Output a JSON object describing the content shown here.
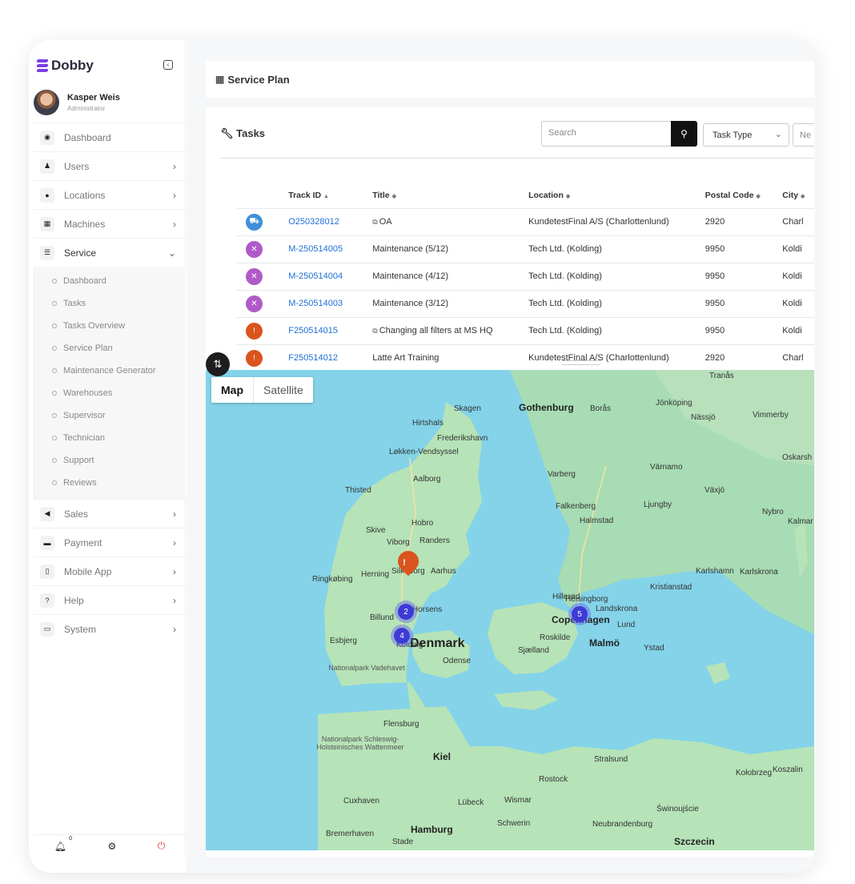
{
  "app": {
    "name": "Dobby"
  },
  "user": {
    "name": "Kasper Weis",
    "role": "Administrator"
  },
  "sidebar": {
    "items": [
      {
        "label": "Dashboard",
        "icon": "dashboard-icon",
        "glyph": "◉",
        "chevron": ""
      },
      {
        "label": "Users",
        "icon": "users-icon",
        "glyph": "♟",
        "chevron": "›"
      },
      {
        "label": "Locations",
        "icon": "location-pin-icon",
        "glyph": "●",
        "chevron": "›"
      },
      {
        "label": "Machines",
        "icon": "machine-icon",
        "glyph": "▦",
        "chevron": "›"
      },
      {
        "label": "Service",
        "icon": "list-icon",
        "glyph": "☰",
        "chevron": "⌄"
      }
    ],
    "service_sub": [
      "Dashboard",
      "Tasks",
      "Tasks Overview",
      "Service Plan",
      "Maintenance Generator",
      "Warehouses",
      "Supervisor",
      "Technician",
      "Support",
      "Reviews"
    ],
    "items_after": [
      {
        "label": "Sales",
        "icon": "megaphone-icon",
        "glyph": "◀",
        "chevron": "›"
      },
      {
        "label": "Payment",
        "icon": "credit-card-icon",
        "glyph": "▬",
        "chevron": "›"
      },
      {
        "label": "Mobile App",
        "icon": "mobile-icon",
        "glyph": "▯",
        "chevron": "›"
      },
      {
        "label": "Help",
        "icon": "help-icon",
        "glyph": "?",
        "chevron": "›"
      },
      {
        "label": "System",
        "icon": "laptop-icon",
        "glyph": "▭",
        "chevron": "›"
      }
    ],
    "footer": {
      "notifications": "0"
    }
  },
  "page": {
    "title": "Service Plan"
  },
  "tasks": {
    "title": "Tasks",
    "search_placeholder": "Search",
    "task_type": "Task Type",
    "second_filter": "Ne",
    "columns": [
      "Track ID",
      "Title",
      "Location",
      "Postal Code",
      "City"
    ],
    "column_arrows": [
      "▲",
      "◆",
      "◆",
      "◆",
      "◆"
    ],
    "rows": [
      {
        "status": "blue",
        "glyph": "⛟",
        "id": "O250328012",
        "copy": true,
        "title": "OA",
        "location": "KundetestFinal A/S (Charlottenlund)",
        "postal": "2920",
        "city": "Charl"
      },
      {
        "status": "purple",
        "glyph": "✕",
        "id": "M-250514005",
        "copy": false,
        "title": "Maintenance (5/12)",
        "location": "Tech Ltd. (Kolding)",
        "postal": "9950",
        "city": "Koldi"
      },
      {
        "status": "purple",
        "glyph": "✕",
        "id": "M-250514004",
        "copy": false,
        "title": "Maintenance (4/12)",
        "location": "Tech Ltd. (Kolding)",
        "postal": "9950",
        "city": "Koldi"
      },
      {
        "status": "purple",
        "glyph": "✕",
        "id": "M-250514003",
        "copy": false,
        "title": "Maintenance (3/12)",
        "location": "Tech Ltd. (Kolding)",
        "postal": "9950",
        "city": "Koldi"
      },
      {
        "status": "orange",
        "glyph": "!",
        "id": "F250514015",
        "copy": true,
        "title": "Changing all filters at MS HQ",
        "location": "Tech Ltd. (Kolding)",
        "postal": "9950",
        "city": "Koldi"
      },
      {
        "status": "orange",
        "glyph": "!",
        "id": "F250514012",
        "copy": false,
        "title": "Latte Art Training",
        "location": "KundetestFinal A/S (Charlottenlund)",
        "postal": "2920",
        "city": "Charl"
      }
    ]
  },
  "map": {
    "toggle": {
      "map": "Map",
      "satellite": "Satellite"
    },
    "clusters": [
      {
        "count": "2"
      },
      {
        "count": "4"
      },
      {
        "count": "5"
      }
    ],
    "labels": [
      {
        "text": "Denmark",
        "size": "big"
      },
      {
        "text": "Gothenburg",
        "size": "med"
      },
      {
        "text": "Copenhagen",
        "size": "med"
      },
      {
        "text": "Malmö",
        "size": "med"
      },
      {
        "text": "Hamburg",
        "size": "med"
      },
      {
        "text": "Szczecin",
        "size": "med"
      },
      {
        "text": "Kiel",
        "size": "med"
      },
      {
        "text": "Aalborg",
        "size": "normal"
      },
      {
        "text": "Aarhus",
        "size": "normal"
      },
      {
        "text": "Randers",
        "size": "normal"
      },
      {
        "text": "Odense",
        "size": "normal"
      },
      {
        "text": "Kolding",
        "size": "normal"
      },
      {
        "text": "Horsens",
        "size": "normal"
      },
      {
        "text": "Esbjerg",
        "size": "normal"
      },
      {
        "text": "Herning",
        "size": "normal"
      },
      {
        "text": "Viborg",
        "size": "normal"
      },
      {
        "text": "Skive",
        "size": "normal"
      },
      {
        "text": "Thisted",
        "size": "normal"
      },
      {
        "text": "Skagen",
        "size": "normal"
      },
      {
        "text": "Hirtshals",
        "size": "normal"
      },
      {
        "text": "Frederikshavn",
        "size": "normal"
      },
      {
        "text": "Løkken-Vendsyssel",
        "size": "normal"
      },
      {
        "text": "Hobro",
        "size": "normal"
      },
      {
        "text": "Silkeborg",
        "size": "normal"
      },
      {
        "text": "Billund",
        "size": "normal"
      },
      {
        "text": "Ringkøbing",
        "size": "normal"
      },
      {
        "text": "Varberg",
        "size": "normal"
      },
      {
        "text": "Falkenberg",
        "size": "normal"
      },
      {
        "text": "Halmstad",
        "size": "normal"
      },
      {
        "text": "Helsingborg",
        "size": "normal"
      },
      {
        "text": "Hillerød",
        "size": "normal"
      },
      {
        "text": "Landskrona",
        "size": "normal"
      },
      {
        "text": "Lund",
        "size": "normal"
      },
      {
        "text": "Ystad",
        "size": "normal"
      },
      {
        "text": "Roskilde",
        "size": "normal"
      },
      {
        "text": "Sjælland",
        "size": "normal"
      },
      {
        "text": "Kristianstad",
        "size": "normal"
      },
      {
        "text": "Karlshamn",
        "size": "normal"
      },
      {
        "text": "Karlskrona",
        "size": "normal"
      },
      {
        "text": "Nybro",
        "size": "normal"
      },
      {
        "text": "Kalmar",
        "size": "normal"
      },
      {
        "text": "Växjö",
        "size": "normal"
      },
      {
        "text": "Ljungby",
        "size": "normal"
      },
      {
        "text": "Värnamo",
        "size": "normal"
      },
      {
        "text": "Jönköping",
        "size": "normal"
      },
      {
        "text": "Borås",
        "size": "normal"
      },
      {
        "text": "Nässjö",
        "size": "normal"
      },
      {
        "text": "Vimmerby",
        "size": "normal"
      },
      {
        "text": "Oskarsh",
        "size": "normal"
      },
      {
        "text": "Tranås",
        "size": "normal"
      },
      {
        "text": "Flensburg",
        "size": "normal"
      },
      {
        "text": "Rostock",
        "size": "normal"
      },
      {
        "text": "Stralsund",
        "size": "normal"
      },
      {
        "text": "Wismar",
        "size": "normal"
      },
      {
        "text": "Lübeck",
        "size": "normal"
      },
      {
        "text": "Schwerin",
        "size": "normal"
      },
      {
        "text": "Neubrandenburg",
        "size": "normal"
      },
      {
        "text": "Bremerhaven",
        "size": "normal"
      },
      {
        "text": "Stade",
        "size": "normal"
      },
      {
        "text": "Cuxhaven",
        "size": "normal"
      },
      {
        "text": "Kołobrzeg",
        "size": "normal"
      },
      {
        "text": "Koszalin",
        "size": "normal"
      },
      {
        "text": "Świnoujście",
        "size": "normal"
      },
      {
        "text": "Nationalpark Vadehavet",
        "size": "small"
      },
      {
        "text": "Nationalpark Schleswig-Holsteinisches Wattenmeer",
        "size": "small"
      }
    ]
  }
}
